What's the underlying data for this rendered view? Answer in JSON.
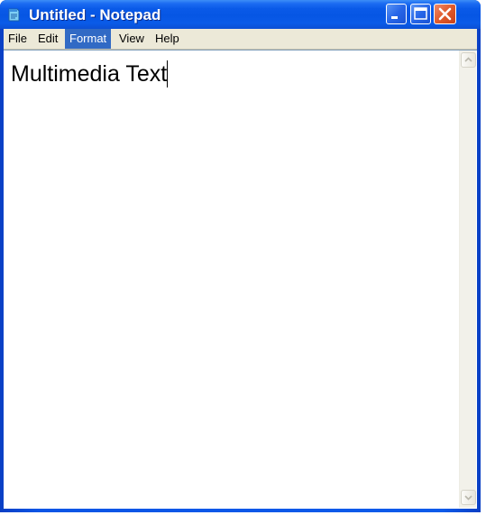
{
  "window": {
    "title": "Untitled - Notepad",
    "icon": "notepad-icon",
    "controls": [
      "minimize-icon",
      "maximize-icon",
      "close-icon"
    ]
  },
  "menu": {
    "items": [
      {
        "label": "File"
      },
      {
        "label": "Edit"
      },
      {
        "label": "Format",
        "active": true
      },
      {
        "label": "View"
      },
      {
        "label": "Help"
      }
    ]
  },
  "editor": {
    "text": "Multimedia Text"
  },
  "scrollbar": {
    "icons": [
      "scroll-up-arrow-icon",
      "scroll-down-arrow-icon"
    ]
  },
  "colors": {
    "titlebar": "#0a5ae8",
    "menu_highlight": "#316ac5",
    "menubar_bg": "#ece9d8",
    "close_button": "#e05a2a"
  }
}
